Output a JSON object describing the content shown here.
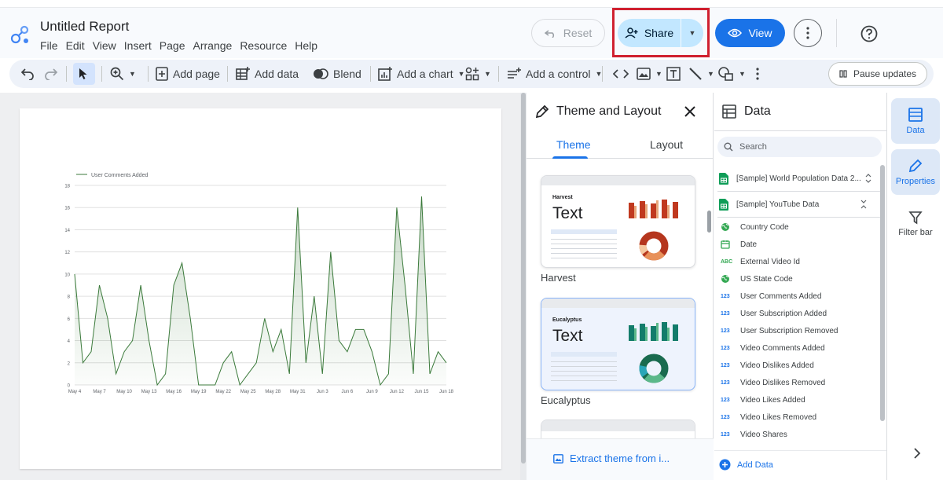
{
  "app": {
    "title": "Untitled Report",
    "menu": [
      "File",
      "Edit",
      "View",
      "Insert",
      "Page",
      "Arrange",
      "Resource",
      "Help"
    ],
    "reset_label": "Reset",
    "share_label": "Share",
    "view_label": "View"
  },
  "toolbar": {
    "add_page": "Add page",
    "add_data": "Add data",
    "blend": "Blend",
    "add_chart": "Add a chart",
    "add_control": "Add a control",
    "pause_updates": "Pause updates"
  },
  "chart_data": {
    "type": "area",
    "legend": "User Comments Added",
    "ylim": [
      0,
      18
    ],
    "yticks": [
      0,
      2,
      4,
      6,
      8,
      10,
      12,
      14,
      16,
      18
    ],
    "xticks": [
      "May 4",
      "May 7",
      "May 10",
      "May 13",
      "May 16",
      "May 19",
      "May 22",
      "May 25",
      "May 28",
      "May 31",
      "Jun 3",
      "Jun 6",
      "Jun 9",
      "Jun 12",
      "Jun 15",
      "Jun 18"
    ],
    "values": [
      10,
      2,
      3,
      9,
      6,
      1,
      3,
      4,
      9,
      4,
      0,
      1,
      9,
      11,
      6,
      0,
      0,
      0,
      2,
      3,
      0,
      1,
      2,
      6,
      3,
      5,
      1,
      16,
      2,
      8,
      1,
      12,
      4,
      3,
      5,
      5,
      3,
      0,
      1,
      16,
      9,
      1,
      17,
      1,
      3,
      2
    ],
    "line_color": "#3b7a3b"
  },
  "theme_panel": {
    "title": "Theme and Layout",
    "tabs": [
      "Theme",
      "Layout"
    ],
    "themes": [
      {
        "name": "Harvest",
        "sample_name": "Harvest",
        "sample_text": "Text"
      },
      {
        "name": "Eucalyptus",
        "sample_name": "Eucalyptus",
        "sample_text": "Text"
      }
    ],
    "extract_label": "Extract theme from i..."
  },
  "data_panel": {
    "title": "Data",
    "search_placeholder": "Search",
    "sources": [
      "[Sample] World Population Data 2...",
      "[Sample] YouTube Data"
    ],
    "fields": [
      {
        "type": "geo",
        "label": "Country Code"
      },
      {
        "type": "date",
        "label": "Date"
      },
      {
        "type": "ABC",
        "label": "External Video Id"
      },
      {
        "type": "geo",
        "label": "US State Code"
      },
      {
        "type": "123",
        "label": "User Comments Added"
      },
      {
        "type": "123",
        "label": "User Subscription Added"
      },
      {
        "type": "123",
        "label": "User Subscription Removed"
      },
      {
        "type": "123",
        "label": "Video Comments Added"
      },
      {
        "type": "123",
        "label": "Video Dislikes Added"
      },
      {
        "type": "123",
        "label": "Video Dislikes Removed"
      },
      {
        "type": "123",
        "label": "Video Likes Added"
      },
      {
        "type": "123",
        "label": "Video Likes Removed"
      },
      {
        "type": "123",
        "label": "Video Shares"
      }
    ],
    "add_data_label": "Add Data"
  },
  "rail": {
    "data_label": "Data",
    "properties_label": "Properties",
    "filter_label": "Filter bar"
  },
  "colors": {
    "accent": "#1a73e8",
    "share_bg": "#c2e7ff",
    "highlight_box": "#d0202f"
  }
}
